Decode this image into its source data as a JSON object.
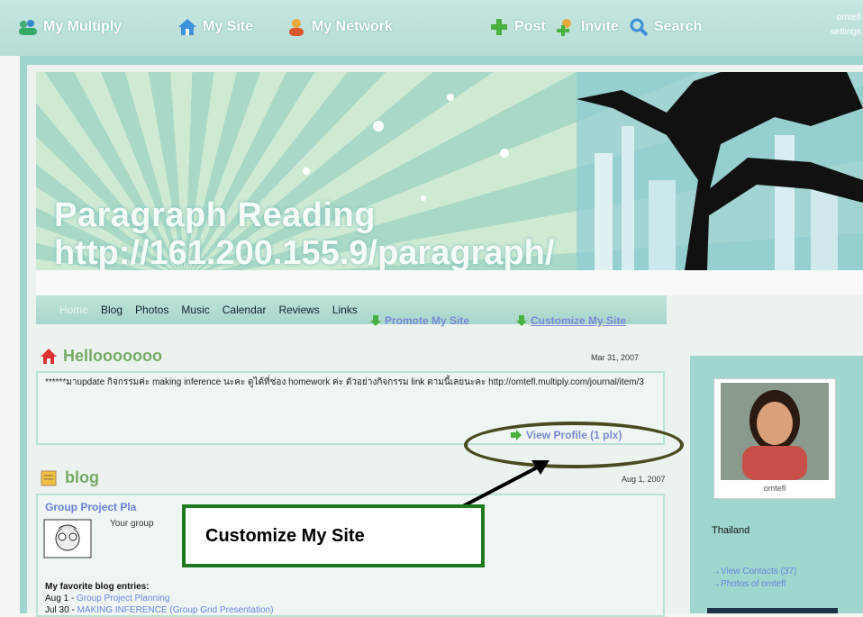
{
  "topnav": {
    "items": [
      {
        "label": "My Multiply",
        "icon": "people-icon"
      },
      {
        "label": "My Site",
        "icon": "house-icon"
      },
      {
        "label": "My Network",
        "icon": "person-icon"
      },
      {
        "label": "Post",
        "icon": "plus-icon"
      },
      {
        "label": "Invite",
        "icon": "invite-icon"
      },
      {
        "label": "Search",
        "icon": "magnifier-icon"
      }
    ],
    "small_top": "omtefl",
    "small_bottom": "settings"
  },
  "banner": {
    "title": "Paragraph Reading",
    "url": "http://161.200.155.9/paragraph/"
  },
  "tabs": [
    "Home",
    "Blog",
    "Photos",
    "Music",
    "Calendar",
    "Reviews",
    "Links"
  ],
  "actions": {
    "promote": "Promote My Site",
    "customize": "Customize My Site"
  },
  "hello": {
    "title": "Hellooooooo",
    "date": "Mar 31, 2007",
    "text": "******มาupdate กิจกรรมค่ะ making inference นะคะ ดูได้ที่ช่อง homework ค่ะ ตัวอย่างกิจกรรม link ตามนี้เลยนะคะ http://omtefl.multiply.com/journal/item/3",
    "view_profile": "View Profile (1 plx)"
  },
  "blog": {
    "title": "blog",
    "date": "Aug 1, 2007",
    "post_title": "Group Project Pla",
    "post_text": "Your group",
    "favorites_label": "My favorite blog entries:",
    "entry1_date": "Aug 1",
    "entry1_title": "Group Project Planning",
    "entry2_date": "Jul 30",
    "entry2_title": "MAKING INFERENCE (Group Grid Presentation)"
  },
  "callout": "Customize My Site",
  "right": {
    "username": "omtefl",
    "country": "Thailand",
    "link1": "View Contacts (37)",
    "link2": "Photos of omtefl"
  },
  "colors": {
    "accent": "#7a88d6",
    "panel": "#9fd6cd",
    "callout_border": "#1d7a1d"
  }
}
